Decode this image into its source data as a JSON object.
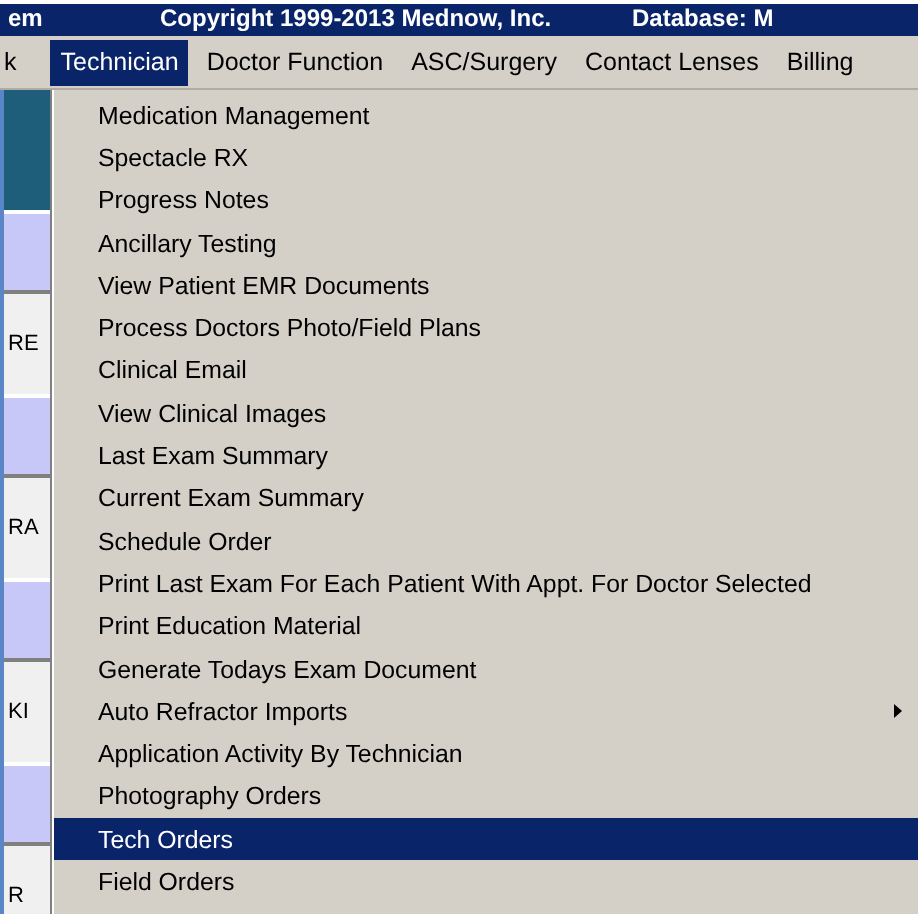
{
  "title_bar": {
    "texts": [
      "em",
      "Copyright 1999-2013 Mednow, Inc.",
      "Database: M"
    ]
  },
  "menu_bar": [
    {
      "label": "k",
      "selected": false
    },
    {
      "label": "Technician",
      "selected": true
    },
    {
      "label": "Doctor Function",
      "selected": false
    },
    {
      "label": "ASC/Surgery",
      "selected": false
    },
    {
      "label": "Contact Lenses",
      "selected": false
    },
    {
      "label": "Billing",
      "selected": false
    }
  ],
  "background_labels": [
    "RE",
    "RA",
    "KI",
    "R"
  ],
  "menu_items": [
    {
      "label": "Medication  Management",
      "selected": false,
      "submenu": false
    },
    {
      "label": "Spectacle RX",
      "selected": false,
      "submenu": false
    },
    {
      "label": "Progress Notes",
      "selected": false,
      "submenu": false
    },
    {
      "label": "Ancillary Testing",
      "selected": false,
      "submenu": false
    },
    {
      "label": "View Patient EMR Documents",
      "selected": false,
      "submenu": false
    },
    {
      "label": "Process Doctors Photo/Field Plans",
      "selected": false,
      "submenu": false
    },
    {
      "label": "Clinical Email",
      "selected": false,
      "submenu": false
    },
    {
      "label": "View Clinical Images",
      "selected": false,
      "submenu": false
    },
    {
      "label": "Last Exam Summary",
      "selected": false,
      "submenu": false
    },
    {
      "label": "Current Exam Summary",
      "selected": false,
      "submenu": false
    },
    {
      "label": "Schedule Order",
      "selected": false,
      "submenu": false
    },
    {
      "label": "Print Last Exam For Each Patient With Appt. For Doctor Selected",
      "selected": false,
      "submenu": false
    },
    {
      "label": "Print Education Material",
      "selected": false,
      "submenu": false
    },
    {
      "label": "Generate Todays Exam Document",
      "selected": false,
      "submenu": false
    },
    {
      "label": "Auto Refractor Imports",
      "selected": false,
      "submenu": true
    },
    {
      "label": "Application Activity By Technician",
      "selected": false,
      "submenu": false
    },
    {
      "label": "Photography Orders",
      "selected": false,
      "submenu": false
    },
    {
      "label": "Tech Orders",
      "selected": true,
      "submenu": false
    },
    {
      "label": "Field Orders",
      "selected": false,
      "submenu": false
    }
  ]
}
